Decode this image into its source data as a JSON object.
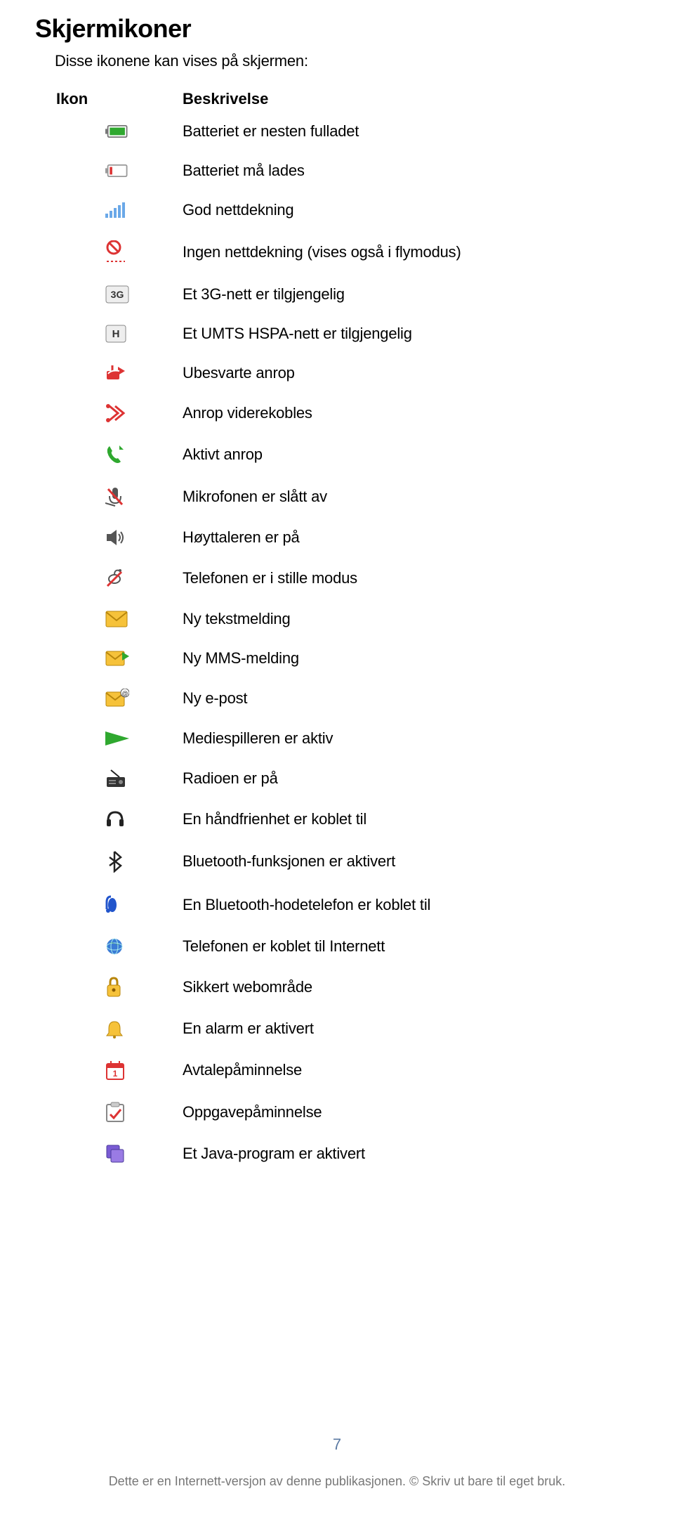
{
  "title": "Skjermikoner",
  "subtitle": "Disse ikonene kan vises på skjermen:",
  "columns": {
    "icon": "Ikon",
    "description": "Beskrivelse"
  },
  "rows": [
    {
      "icon": "battery-full-icon",
      "desc": "Batteriet er nesten fulladet"
    },
    {
      "icon": "battery-empty-icon",
      "desc": "Batteriet må lades"
    },
    {
      "icon": "signal-icon",
      "desc": "God nettdekning"
    },
    {
      "icon": "no-network-icon",
      "desc": "Ingen nettdekning (vises også i flymodus)"
    },
    {
      "icon": "3g-icon",
      "desc": "Et 3G-nett er tilgjengelig"
    },
    {
      "icon": "hspa-icon",
      "desc": "Et UMTS HSPA-nett er tilgjengelig"
    },
    {
      "icon": "missed-call-icon",
      "desc": "Ubesvarte anrop"
    },
    {
      "icon": "call-forwarded-icon",
      "desc": "Anrop viderekobles"
    },
    {
      "icon": "active-call-icon",
      "desc": "Aktivt anrop"
    },
    {
      "icon": "mic-muted-icon",
      "desc": "Mikrofonen er slått av"
    },
    {
      "icon": "speaker-on-icon",
      "desc": "Høyttaleren er på"
    },
    {
      "icon": "silent-mode-icon",
      "desc": "Telefonen er i stille modus"
    },
    {
      "icon": "sms-icon",
      "desc": "Ny tekstmelding"
    },
    {
      "icon": "mms-icon",
      "desc": "Ny MMS-melding"
    },
    {
      "icon": "email-icon",
      "desc": "Ny e-post"
    },
    {
      "icon": "media-player-icon",
      "desc": "Mediespilleren er aktiv"
    },
    {
      "icon": "radio-icon",
      "desc": "Radioen er på"
    },
    {
      "icon": "headset-icon",
      "desc": "En håndfrienhet er koblet til"
    },
    {
      "icon": "bluetooth-icon",
      "desc": "Bluetooth-funksjonen er aktivert"
    },
    {
      "icon": "bluetooth-headset-icon",
      "desc": "En Bluetooth-hodetelefon er koblet til"
    },
    {
      "icon": "internet-icon",
      "desc": "Telefonen er koblet til Internett"
    },
    {
      "icon": "secure-web-icon",
      "desc": "Sikkert webområde"
    },
    {
      "icon": "alarm-icon",
      "desc": "En alarm er aktivert"
    },
    {
      "icon": "calendar-reminder-icon",
      "desc": "Avtalepåminnelse"
    },
    {
      "icon": "task-reminder-icon",
      "desc": "Oppgavepåminnelse"
    },
    {
      "icon": "java-app-icon",
      "desc": "Et Java-program er aktivert"
    }
  ],
  "page_number": "7",
  "footer": "Dette er en Internett-versjon av denne publikasjonen. © Skriv ut bare til eget bruk."
}
